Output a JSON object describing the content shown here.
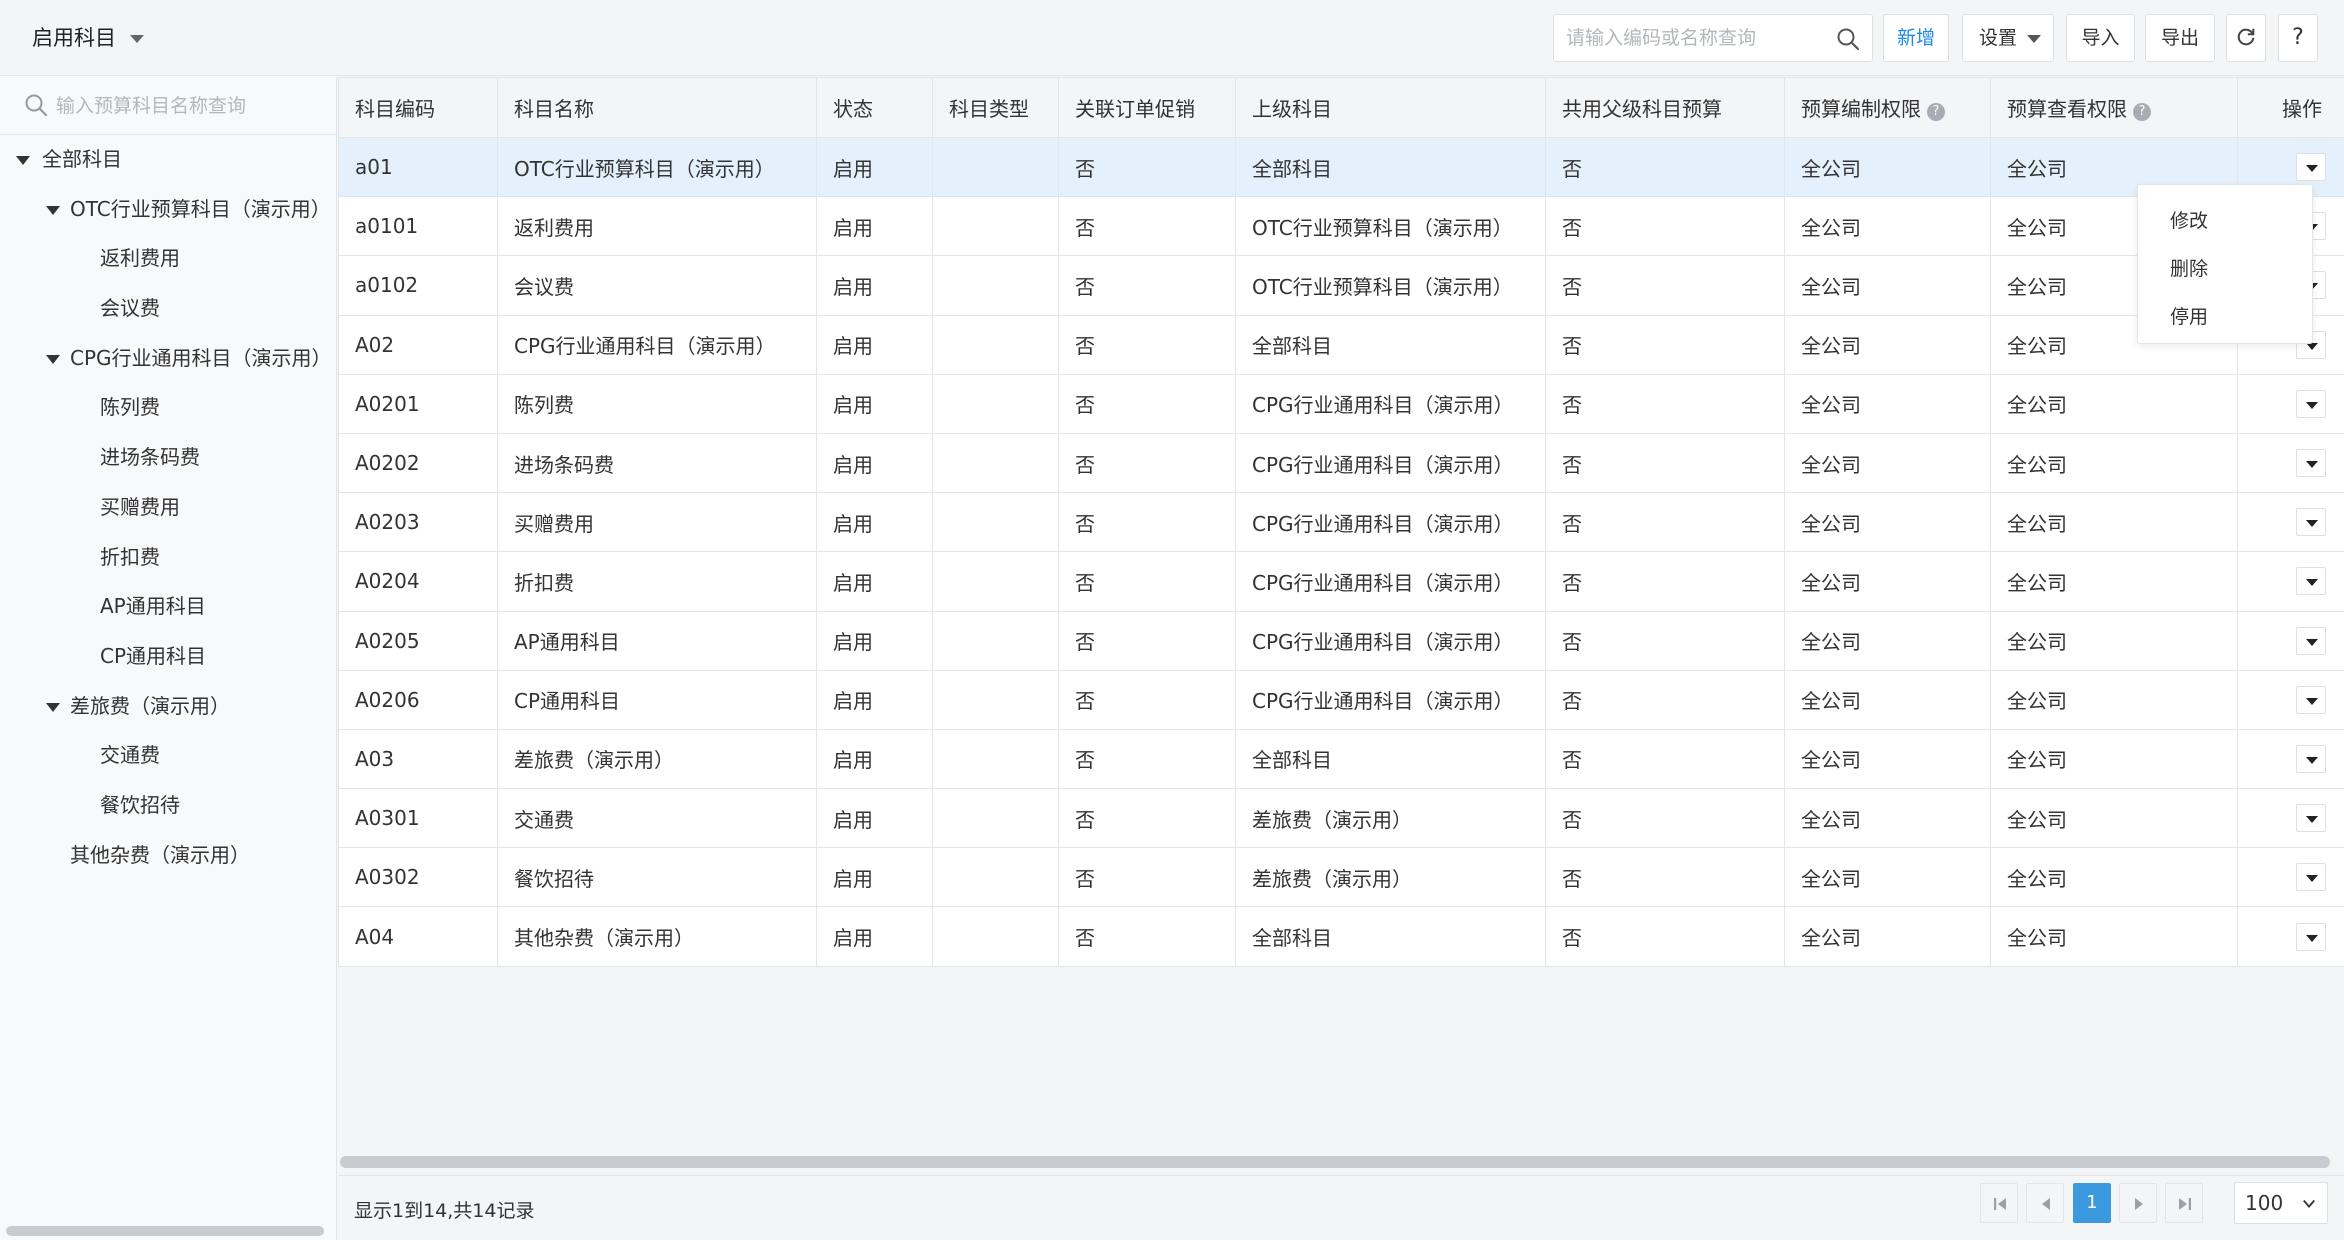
{
  "toolbar": {
    "view_label": "启用科目",
    "search_placeholder": "请输入编码或名称查询",
    "new_label": "新增",
    "settings_label": "设置",
    "import_label": "导入",
    "export_label": "导出",
    "help_label": "?"
  },
  "sidebar": {
    "search_placeholder": "输入预算科目名称查询",
    "tree": [
      {
        "label": "全部科目",
        "level": 0,
        "expanded": true
      },
      {
        "label": "OTC行业预算科目（演示用）",
        "level": 1,
        "expanded": true
      },
      {
        "label": "返利费用",
        "level": 2
      },
      {
        "label": "会议费",
        "level": 2
      },
      {
        "label": "CPG行业通用科目（演示用）",
        "level": 1,
        "expanded": true
      },
      {
        "label": "陈列费",
        "level": 2
      },
      {
        "label": "进场条码费",
        "level": 2
      },
      {
        "label": "买赠费用",
        "level": 2
      },
      {
        "label": "折扣费",
        "level": 2
      },
      {
        "label": "AP通用科目",
        "level": 2
      },
      {
        "label": "CP通用科目",
        "level": 2
      },
      {
        "label": "差旅费（演示用）",
        "level": 1,
        "expanded": true
      },
      {
        "label": "交通费",
        "level": 2
      },
      {
        "label": "餐饮招待",
        "level": 2
      },
      {
        "label": "其他杂费（演示用）",
        "level": 1
      }
    ]
  },
  "table": {
    "columns": [
      "科目编码",
      "科目名称",
      "状态",
      "科目类型",
      "关联订单促销",
      "上级科目",
      "共用父级科目预算",
      "预算编制权限",
      "预算查看权限",
      "操作"
    ],
    "help_mark": "?",
    "rows": [
      [
        "a01",
        "OTC行业预算科目（演示用）",
        "启用",
        "",
        "否",
        "全部科目",
        "否",
        "全公司",
        "全公司"
      ],
      [
        "a0101",
        "返利费用",
        "启用",
        "",
        "否",
        "OTC行业预算科目（演示用）",
        "否",
        "全公司",
        "全公司"
      ],
      [
        "a0102",
        "会议费",
        "启用",
        "",
        "否",
        "OTC行业预算科目（演示用）",
        "否",
        "全公司",
        "全公司"
      ],
      [
        "A02",
        "CPG行业通用科目（演示用）",
        "启用",
        "",
        "否",
        "全部科目",
        "否",
        "全公司",
        "全公司"
      ],
      [
        "A0201",
        "陈列费",
        "启用",
        "",
        "否",
        "CPG行业通用科目（演示用）",
        "否",
        "全公司",
        "全公司"
      ],
      [
        "A0202",
        "进场条码费",
        "启用",
        "",
        "否",
        "CPG行业通用科目（演示用）",
        "否",
        "全公司",
        "全公司"
      ],
      [
        "A0203",
        "买赠费用",
        "启用",
        "",
        "否",
        "CPG行业通用科目（演示用）",
        "否",
        "全公司",
        "全公司"
      ],
      [
        "A0204",
        "折扣费",
        "启用",
        "",
        "否",
        "CPG行业通用科目（演示用）",
        "否",
        "全公司",
        "全公司"
      ],
      [
        "A0205",
        "AP通用科目",
        "启用",
        "",
        "否",
        "CPG行业通用科目（演示用）",
        "否",
        "全公司",
        "全公司"
      ],
      [
        "A0206",
        "CP通用科目",
        "启用",
        "",
        "否",
        "CPG行业通用科目（演示用）",
        "否",
        "全公司",
        "全公司"
      ],
      [
        "A03",
        "差旅费（演示用）",
        "启用",
        "",
        "否",
        "全部科目",
        "否",
        "全公司",
        "全公司"
      ],
      [
        "A0301",
        "交通费",
        "启用",
        "",
        "否",
        "差旅费（演示用）",
        "否",
        "全公司",
        "全公司"
      ],
      [
        "A0302",
        "餐饮招待",
        "启用",
        "",
        "否",
        "差旅费（演示用）",
        "否",
        "全公司",
        "全公司"
      ],
      [
        "A04",
        "其他杂费（演示用）",
        "启用",
        "",
        "否",
        "全部科目",
        "否",
        "全公司",
        "全公司"
      ]
    ],
    "selected_row": 0,
    "row_menu": [
      "修改",
      "删除",
      "停用"
    ]
  },
  "footer": {
    "summary": "显示1到14,共14记录",
    "current_page": "1",
    "page_size": "100"
  },
  "colors": {
    "accent": "#1e88e5",
    "selected_row": "#e4f1fc",
    "page_active": "#3b99e0"
  }
}
